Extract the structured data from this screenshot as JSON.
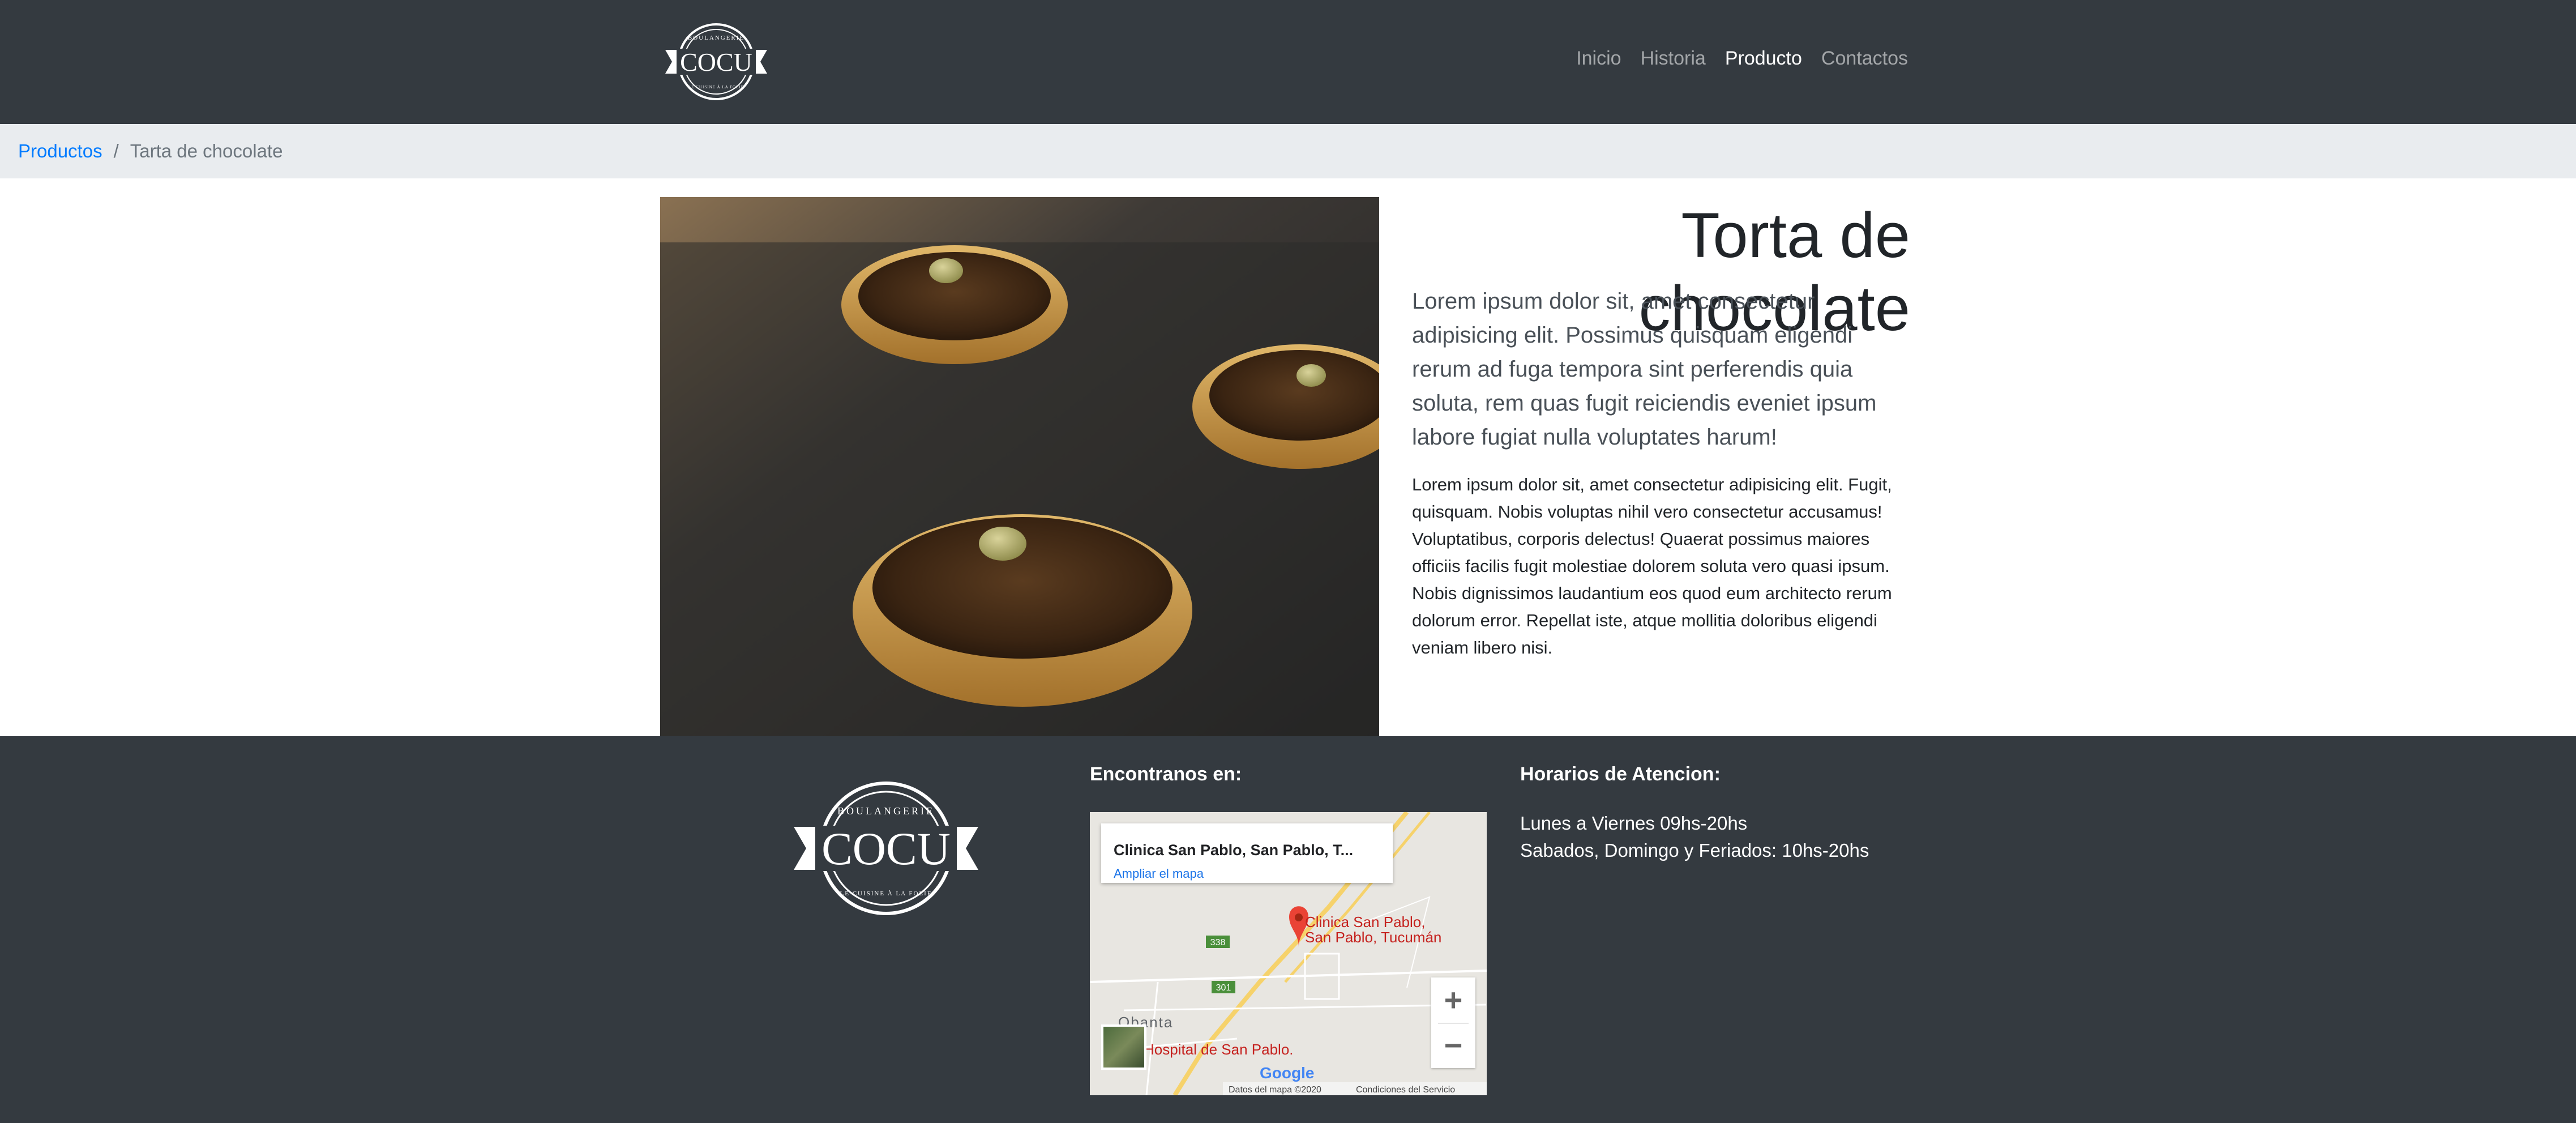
{
  "brand": {
    "top_text": "BOULANGERIE",
    "name": "COCU",
    "bottom_text": "LE CUISINE À LA FOLIE"
  },
  "nav": {
    "items": [
      {
        "label": "Inicio",
        "active": false
      },
      {
        "label": "Historia",
        "active": false
      },
      {
        "label": "Producto",
        "active": true
      },
      {
        "label": "Contactos",
        "active": false
      }
    ]
  },
  "breadcrumb": {
    "parent": "Productos",
    "separator": "/",
    "current": "Tarta de chocolate"
  },
  "product": {
    "title": "Torta de chocolate",
    "lead": "Lorem ipsum dolor sit, amet consectetur adipisicing elit. Possimus quisquam eligendi rerum ad fuga tempora sint perferendis quia soluta, rem quas fugit reiciendis eveniet ipsum labore fugiat nulla voluptates harum!",
    "description": "Lorem ipsum dolor sit, amet consectetur adipisicing elit. Fugit, quisquam. Nobis voluptas nihil vero consectetur accusamus! Voluptatibus, corporis delectus! Quaerat possimus maiores officiis facilis fugit molestiae dolorem soluta vero quasi ipsum. Nobis dignissimos laudantium eos quod eum architecto rerum dolorum error. Repellat iste, atque mollitia doloribus eligendi veniam libero nisi."
  },
  "footer": {
    "map_heading": "Encontranos en:",
    "map": {
      "place_title": "Clinica San Pablo, San Pablo, T...",
      "enlarge_link": "Ampliar el mapa",
      "marker_label_1": "Clinica San Pablo,",
      "marker_label_2": "San Pablo, Tucumán",
      "route_338": "338",
      "route_301": "301",
      "town": "Obanta",
      "hospital": "Hospital de San Pablo.",
      "google": "Google",
      "map_data": "Datos del mapa ©2020",
      "terms": "Condiciones del Servicio",
      "zoom_in": "+",
      "zoom_out": "−"
    },
    "hours_heading": "Horarios de Atencion:",
    "hours": [
      "Lunes a Viernes 09hs-20hs",
      "Sabados, Domingo y Feriados: 10hs-20hs"
    ]
  },
  "colors": {
    "navbar_bg": "#343a40",
    "breadcrumb_bg": "#e9ecef",
    "link": "#007bff",
    "map_marker": "#ea4335"
  }
}
